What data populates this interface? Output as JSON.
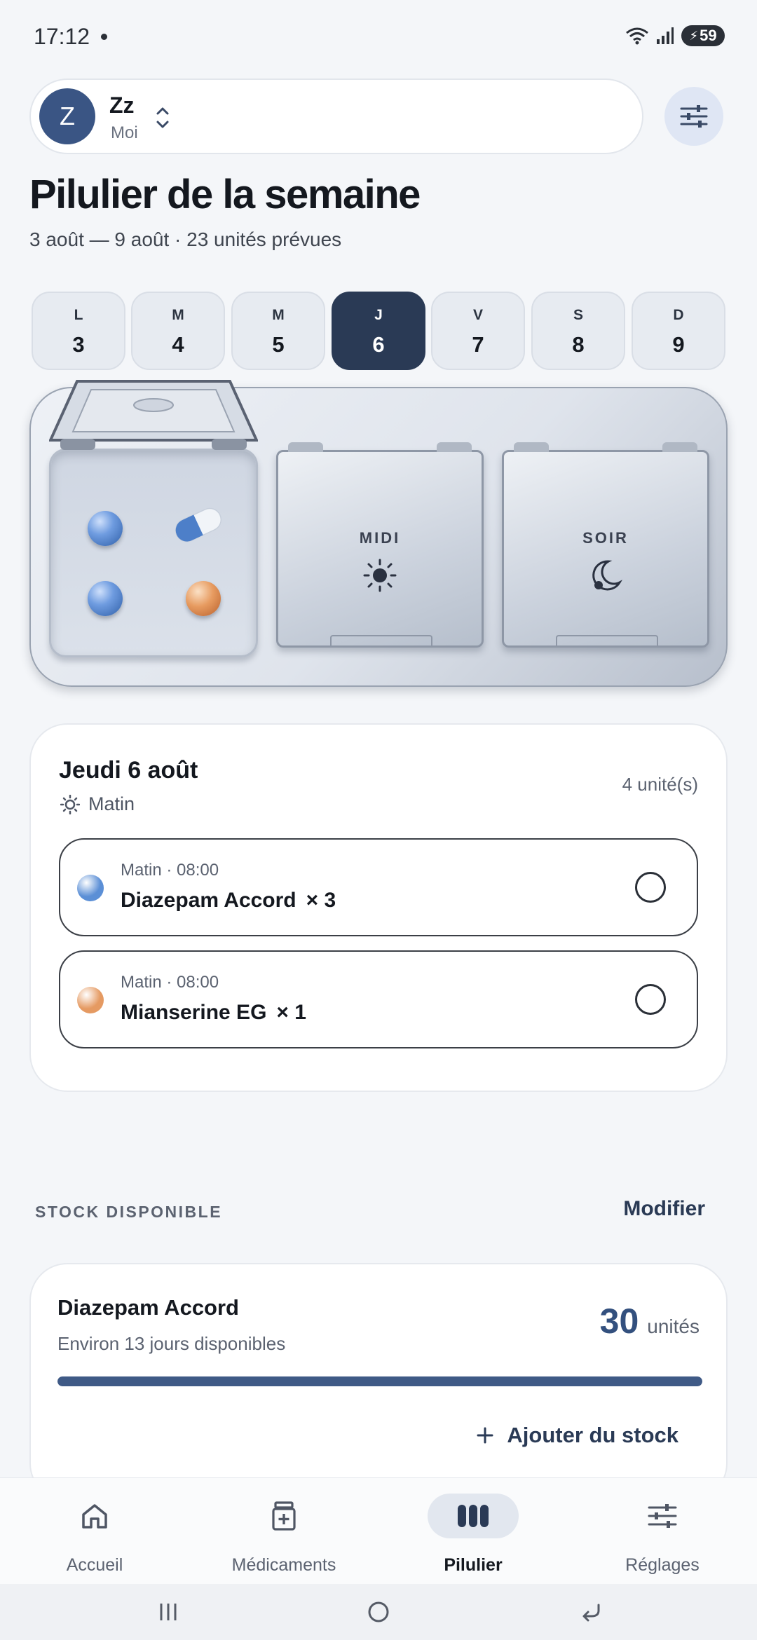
{
  "status_bar": {
    "time": "17:12",
    "battery": "59",
    "icons": [
      "wifi-icon",
      "signal-icon",
      "battery-charging-icon"
    ]
  },
  "profile": {
    "avatar_letter": "Z",
    "name": "Zz",
    "subtitle": "Moi"
  },
  "header": {
    "title": "Pilulier de la semaine",
    "subtitle": "3 août — 9 août · 23 unités prévues"
  },
  "days": [
    {
      "letter": "L",
      "num": "3",
      "active": false
    },
    {
      "letter": "M",
      "num": "4",
      "active": false
    },
    {
      "letter": "M",
      "num": "5",
      "active": false
    },
    {
      "letter": "J",
      "num": "6",
      "active": true
    },
    {
      "letter": "V",
      "num": "7",
      "active": false
    },
    {
      "letter": "S",
      "num": "8",
      "active": false
    },
    {
      "letter": "D",
      "num": "9",
      "active": false
    }
  ],
  "pillbox": {
    "midi_label": "MIDI",
    "soir_label": "SOIR"
  },
  "day_card": {
    "title": "Jeudi 6 août",
    "period": "Matin",
    "count": "4 unité(s)",
    "doses": [
      {
        "time": "Matin · 08:00",
        "name": "Diazepam Accord",
        "qty": "× 3",
        "color": "#5b8fd6",
        "taken": false
      },
      {
        "time": "Matin · 08:00",
        "name": "Mianserine EG",
        "qty": "× 1",
        "color": "#e59a62",
        "taken": false
      }
    ]
  },
  "stock": {
    "heading": "STOCK DISPONIBLE",
    "edit_label": "Modifier",
    "item": {
      "name": "Diazepam Accord",
      "days_left": "Environ 13 jours disponibles",
      "qty": "30",
      "unit": "unités",
      "level_fraction": 1.0
    },
    "add_label": "Ajouter du stock"
  },
  "nav": [
    {
      "label": "Accueil",
      "icon": "home-icon",
      "active": false
    },
    {
      "label": "Médicaments",
      "icon": "medicine-box-icon",
      "active": false
    },
    {
      "label": "Pilulier",
      "icon": "pillbox-icon",
      "active": true
    },
    {
      "label": "Réglages",
      "icon": "sliders-icon",
      "active": false
    }
  ],
  "colors": {
    "accent": "#2a3a55",
    "avatar": "#3a5584",
    "stock_bar": "#3f5a86",
    "background": "#f4f6f9"
  }
}
